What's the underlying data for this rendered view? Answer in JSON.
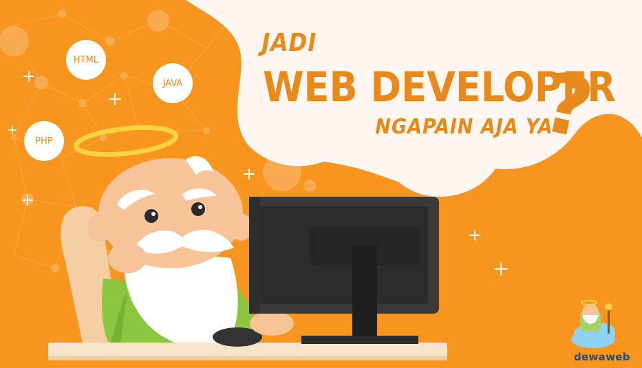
{
  "headline": {
    "line1": "JADI",
    "line2": "WEB DEVELOPER",
    "line3": "NGAPAIN AJA YA",
    "question_mark": "?"
  },
  "bubbles": {
    "html": "HTML",
    "java": "JAVA",
    "php": "PHP"
  },
  "brand": {
    "name": "dewaweb"
  },
  "colors": {
    "background": "#f7951f",
    "cloud": "#fdf7ef",
    "title": "#e8891c",
    "monitor": "#3a3a3a",
    "halo": "#ffd23f",
    "shirt": "#8cc63f",
    "skin": "#f7c49a",
    "desk": "#f7e4c9"
  }
}
